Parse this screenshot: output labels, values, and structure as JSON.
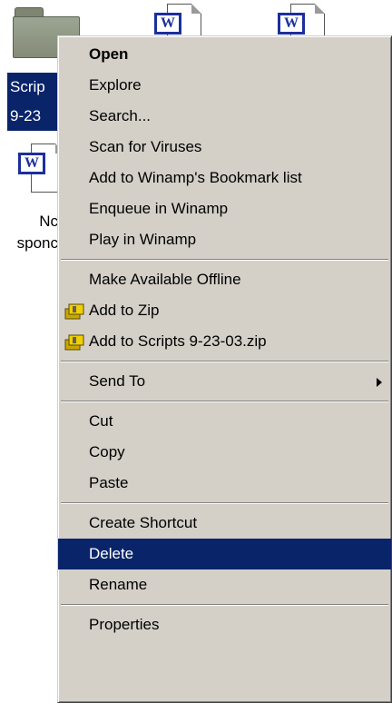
{
  "desktop": {
    "selected_label_lines": [
      "Scrip",
      "9-23"
    ],
    "doc_label_lines": [
      "Nc",
      "sponc"
    ],
    "word_badge": "W"
  },
  "menu": {
    "items": [
      {
        "label": "Open"
      },
      {
        "label": "Explore"
      },
      {
        "label": "Search..."
      },
      {
        "label": "Scan for Viruses"
      },
      {
        "label": "Add to Winamp's Bookmark list"
      },
      {
        "label": "Enqueue in Winamp"
      },
      {
        "label": "Play in Winamp"
      },
      {
        "label": "Make Available Offline"
      },
      {
        "label": "Add to Zip"
      },
      {
        "label": "Add to Scripts 9-23-03.zip"
      },
      {
        "label": "Send To"
      },
      {
        "label": "Cut"
      },
      {
        "label": "Copy"
      },
      {
        "label": "Paste"
      },
      {
        "label": "Create Shortcut"
      },
      {
        "label": "Delete"
      },
      {
        "label": "Rename"
      },
      {
        "label": "Properties"
      }
    ],
    "highlighted_item": "Delete",
    "highlight_color": "#0a246a",
    "menu_background": "#d4d0c8"
  }
}
